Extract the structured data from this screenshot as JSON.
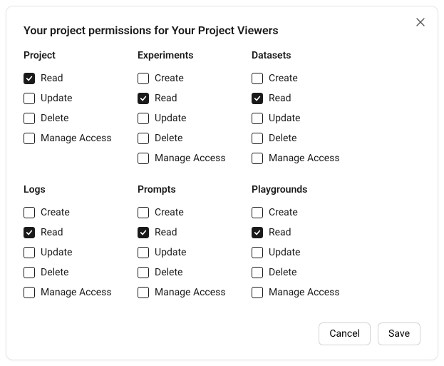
{
  "dialog": {
    "title": "Your project permissions for Your Project Viewers",
    "cancel_label": "Cancel",
    "save_label": "Save"
  },
  "sections": [
    {
      "title": "Project",
      "perms": [
        {
          "label": "Read",
          "checked": true
        },
        {
          "label": "Update",
          "checked": false
        },
        {
          "label": "Delete",
          "checked": false
        },
        {
          "label": "Manage Access",
          "checked": false
        }
      ]
    },
    {
      "title": "Experiments",
      "perms": [
        {
          "label": "Create",
          "checked": false
        },
        {
          "label": "Read",
          "checked": true
        },
        {
          "label": "Update",
          "checked": false
        },
        {
          "label": "Delete",
          "checked": false
        },
        {
          "label": "Manage Access",
          "checked": false
        }
      ]
    },
    {
      "title": "Datasets",
      "perms": [
        {
          "label": "Create",
          "checked": false
        },
        {
          "label": "Read",
          "checked": true
        },
        {
          "label": "Update",
          "checked": false
        },
        {
          "label": "Delete",
          "checked": false
        },
        {
          "label": "Manage Access",
          "checked": false
        }
      ]
    },
    {
      "title": "Logs",
      "perms": [
        {
          "label": "Create",
          "checked": false
        },
        {
          "label": "Read",
          "checked": true
        },
        {
          "label": "Update",
          "checked": false
        },
        {
          "label": "Delete",
          "checked": false
        },
        {
          "label": "Manage Access",
          "checked": false
        }
      ]
    },
    {
      "title": "Prompts",
      "perms": [
        {
          "label": "Create",
          "checked": false
        },
        {
          "label": "Read",
          "checked": true
        },
        {
          "label": "Update",
          "checked": false
        },
        {
          "label": "Delete",
          "checked": false
        },
        {
          "label": "Manage Access",
          "checked": false
        }
      ]
    },
    {
      "title": "Playgrounds",
      "perms": [
        {
          "label": "Create",
          "checked": false
        },
        {
          "label": "Read",
          "checked": true
        },
        {
          "label": "Update",
          "checked": false
        },
        {
          "label": "Delete",
          "checked": false
        },
        {
          "label": "Manage Access",
          "checked": false
        }
      ]
    }
  ]
}
